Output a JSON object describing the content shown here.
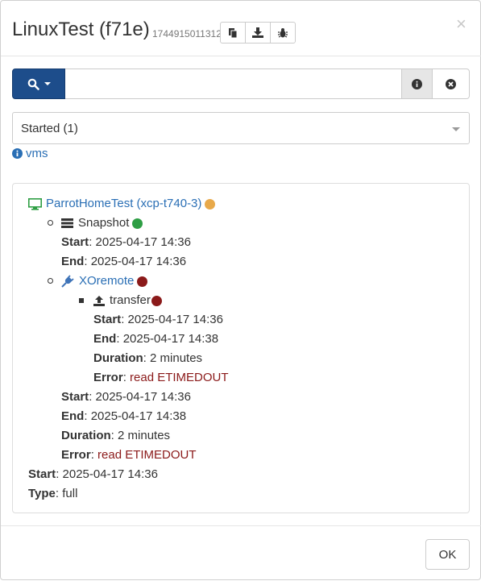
{
  "header": {
    "title": "LinuxTest (f71e)",
    "id": "1744915011312",
    "close_symbol": "×",
    "buttons": [
      "copy-icon",
      "download-icon",
      "bug-icon"
    ]
  },
  "search": {
    "value": "",
    "placeholder": ""
  },
  "filter": {
    "selected": "Started (1)"
  },
  "vms_link": "vms",
  "log": {
    "vm": {
      "label": "ParrotHomeTest (xcp-t740-3)",
      "status_color": "#e8a94a"
    },
    "snapshot": {
      "label": "Snapshot",
      "status_color": "#2e9e44",
      "start_label": "Start",
      "start": "2025-04-17 14:36",
      "end_label": "End",
      "end": "2025-04-17 14:36"
    },
    "remote": {
      "label": "XOremote",
      "status_color": "#8b1a1a",
      "transfer": {
        "label": "transfer",
        "status_color": "#8b1a1a",
        "start_label": "Start",
        "start": "2025-04-17 14:36",
        "end_label": "End",
        "end": "2025-04-17 14:38",
        "duration_label": "Duration",
        "duration": "2 minutes",
        "error_label": "Error",
        "error": "read ETIMEDOUT"
      },
      "start_label": "Start",
      "start": "2025-04-17 14:36",
      "end_label": "End",
      "end": "2025-04-17 14:38",
      "duration_label": "Duration",
      "duration": "2 minutes",
      "error_label": "Error",
      "error": "read ETIMEDOUT"
    },
    "start_label": "Start",
    "start": "2025-04-17 14:36",
    "type_label": "Type",
    "type": "full"
  },
  "footer": {
    "ok_label": "OK"
  },
  "colors": {
    "primary": "#1d4d8b",
    "link": "#2a6fb5",
    "error": "#8b1a1a",
    "success": "#2e9e44",
    "warning": "#e8a94a",
    "vm_icon": "#2e9e44"
  }
}
